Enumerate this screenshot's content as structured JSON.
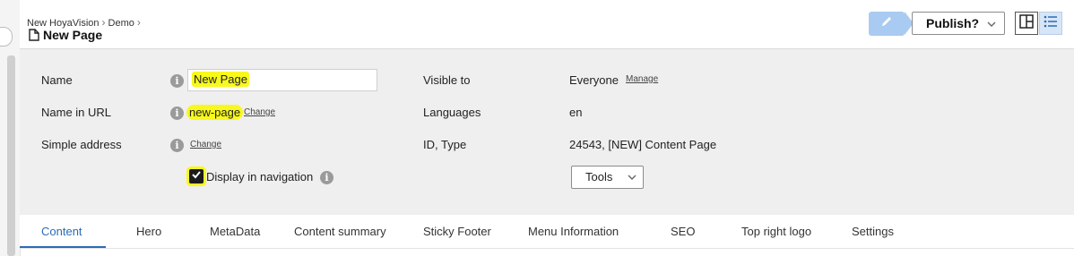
{
  "breadcrumb": {
    "items": [
      "New HoyaVision",
      "Demo"
    ]
  },
  "page": {
    "title": "New Page"
  },
  "toolbar": {
    "publish_label": "Publish?"
  },
  "properties": {
    "name_label": "Name",
    "name_value": "New Page",
    "url_label": "Name in URL",
    "url_value": "new-page",
    "url_change": "Change",
    "simple_label": "Simple address",
    "simple_change": "Change",
    "display_nav_label": "Display in navigation",
    "display_nav_checked": true,
    "visible_label": "Visible to",
    "visible_value": "Everyone",
    "visible_manage": "Manage",
    "languages_label": "Languages",
    "languages_value": "en",
    "id_label": "ID, Type",
    "id_value": "24543, [NEW] Content Page",
    "tools_label": "Tools"
  },
  "tabs": [
    {
      "label": "Content",
      "active": true
    },
    {
      "label": "Hero"
    },
    {
      "label": "MetaData"
    },
    {
      "label": "Content summary"
    },
    {
      "label": "Sticky Footer"
    },
    {
      "label": "Menu Information"
    },
    {
      "label": "SEO"
    },
    {
      "label": "Top right logo"
    },
    {
      "label": "Settings"
    }
  ],
  "colors": {
    "accent": "#2b6cb5",
    "edit_button": "#a9cbf1",
    "highlight": "#f8f81d"
  },
  "icons": [
    "page-icon",
    "pencil-icon",
    "chevron-down-icon",
    "split-view-icon",
    "list-view-icon",
    "info-icon",
    "checkmark-icon"
  ]
}
